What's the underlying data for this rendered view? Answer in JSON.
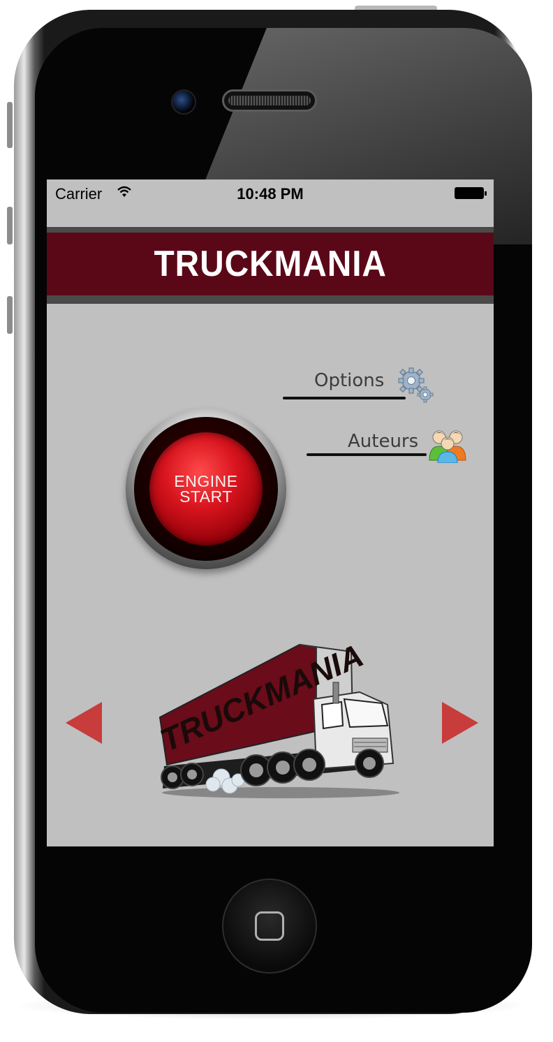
{
  "status_bar": {
    "carrier": "Carrier",
    "time": "10:48 PM"
  },
  "header": {
    "title": "TRUCKMANIA",
    "background_color": "#5a0818"
  },
  "menu": {
    "options_label": "Options",
    "auteurs_label": "Auteurs"
  },
  "engine_button": {
    "line1": "ENGINE",
    "line2": "START"
  },
  "truck": {
    "trailer_text": "TRUCKMANIA"
  },
  "icons": {
    "wifi": "wifi-icon",
    "battery": "battery-icon",
    "options": "gear-icon",
    "auteurs": "people-icon",
    "prev": "left-arrow-icon",
    "next": "right-arrow-icon",
    "home": "home-button-icon"
  },
  "colors": {
    "screen_background": "#c0c0c0",
    "arrow": "#c83c3c",
    "engine_red": "#d8141e"
  }
}
